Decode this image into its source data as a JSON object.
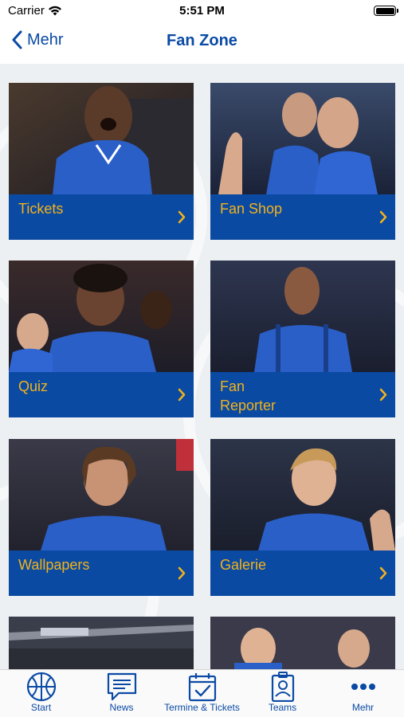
{
  "status_bar": {
    "carrier": "Carrier",
    "time": "5:51 PM"
  },
  "nav": {
    "back_label": "Mehr",
    "title": "Fan Zone"
  },
  "colors": {
    "brand_blue": "#0b4aa2",
    "accent_yellow": "#f2b21b",
    "background": "#edf0f3"
  },
  "tiles": [
    {
      "label": "Tickets"
    },
    {
      "label": "Fan Shop"
    },
    {
      "label": "Quiz"
    },
    {
      "label": "Fan\nReporter"
    },
    {
      "label": "Wallpapers"
    },
    {
      "label": "Galerie"
    }
  ],
  "tab_bar": {
    "items": [
      {
        "label": "Start",
        "icon": "basketball-icon"
      },
      {
        "label": "News",
        "icon": "chat-bubble-icon"
      },
      {
        "label": "Termine & Tickets",
        "icon": "calendar-check-icon"
      },
      {
        "label": "Teams",
        "icon": "id-badge-icon"
      },
      {
        "label": "Mehr",
        "icon": "more-dots-icon"
      }
    ]
  }
}
